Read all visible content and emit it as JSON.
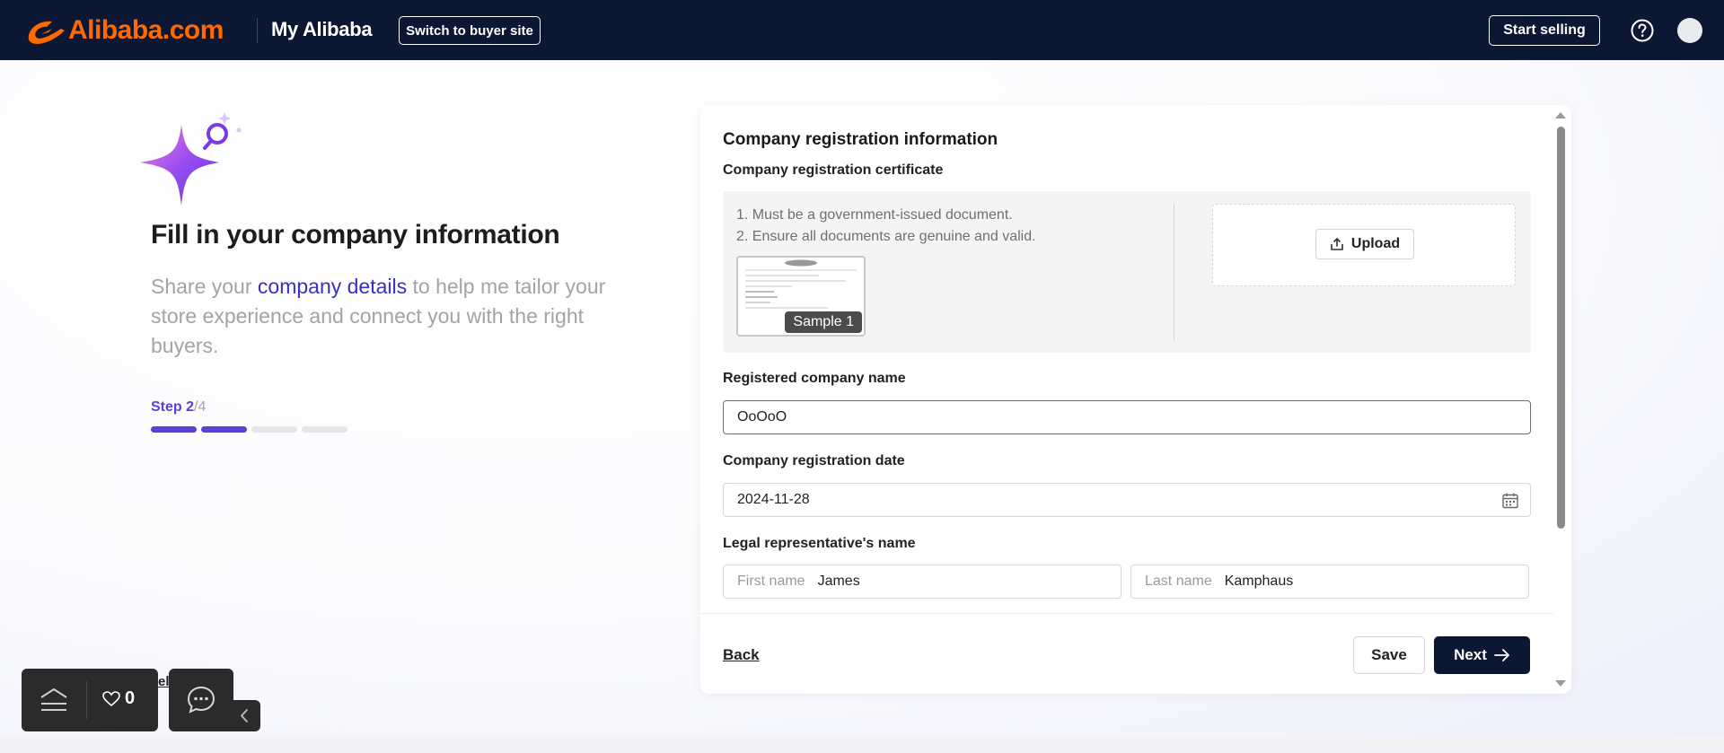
{
  "nav": {
    "logo_text": "Alibaba.com",
    "title": "My Alibaba",
    "switch_label": "Switch to buyer site",
    "sell_label": "Start selling",
    "help_icon": "help-circle-icon",
    "brand_color": "#ff6a00",
    "bg_color": "#0c1733"
  },
  "intro": {
    "title": "Fill in your company information",
    "sub_pre": "Share your ",
    "sub_link": "company details",
    "sub_post": " to help me tailor your store experience and connect you with the right buyers.",
    "step_current": "Step 2",
    "step_total": "/4",
    "progress": {
      "current": 2,
      "total": 4
    },
    "accent_color": "#5b3fd6"
  },
  "form": {
    "section_title": "Company registration information",
    "certificate": {
      "label": "Company registration certificate",
      "rule_1": "1. Must be a government-issued document.",
      "rule_2": "2. Ensure all documents are genuine and valid.",
      "sample_label": "Sample 1",
      "upload_label": "Upload"
    },
    "company_name": {
      "label": "Registered company name",
      "value": "OoOoO"
    },
    "reg_date": {
      "label": "Company registration date",
      "value": "2024-11-28"
    },
    "legal_rep": {
      "label": "Legal representative's name",
      "first_placeholder": "First name",
      "first_value": "James",
      "last_placeholder": "Last name",
      "last_value": "Kamphaus"
    }
  },
  "footer": {
    "back_label": "Back",
    "save_label": "Save",
    "next_label": "Next"
  },
  "widgets": {
    "favorites_count": "0",
    "peek_text": "el"
  }
}
